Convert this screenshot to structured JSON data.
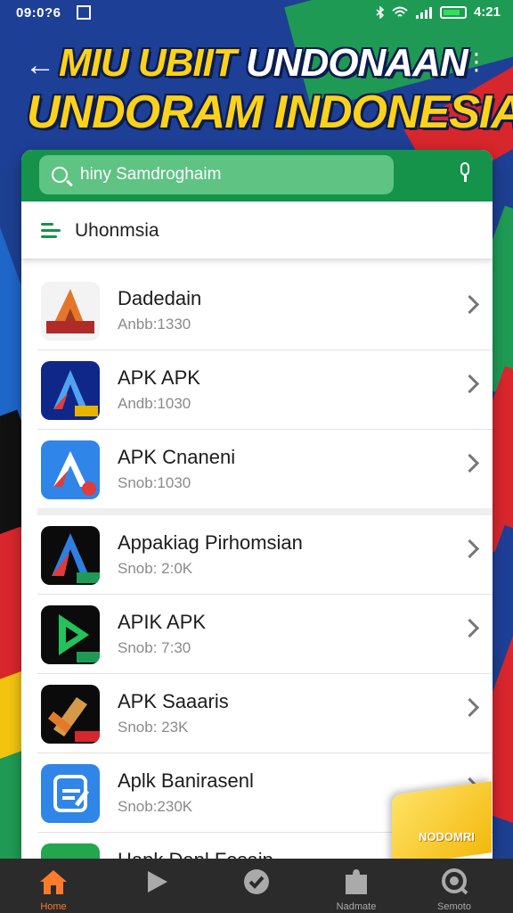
{
  "status_bar": {
    "time": "09:0?6",
    "right_text": "4:21"
  },
  "header": {
    "title_line1_yellow": "MIU UBIIT",
    "title_line1_white": "UNDONAAN",
    "title_line2": "UNDORAM INDONESIA"
  },
  "search": {
    "placeholder": "hiny Samdroghaim",
    "value": ""
  },
  "filter": {
    "label": "Uhonmsia"
  },
  "apps": [
    {
      "title": "Dadedain",
      "subtitle": "Anbb:1330"
    },
    {
      "title": "APK APK",
      "subtitle": "Andb:1030"
    },
    {
      "title": "APK Cnaneni",
      "subtitle": "Snob:1030"
    },
    {
      "title": "Appakiag Pirhomsian",
      "subtitle": "Snob: 2:0K"
    },
    {
      "title": "APIK APK",
      "subtitle": "Snob: 7:30"
    },
    {
      "title": "APK Saaaris",
      "subtitle": "Snob: 23K"
    },
    {
      "title": "Aplk Banirasenl",
      "subtitle": "Snob:230K"
    },
    {
      "title": "Hapk Dapl Fosaip",
      "subtitle": ""
    }
  ],
  "promo": {
    "text": "NODOMRI"
  },
  "nav": {
    "items": [
      {
        "label": "Home"
      },
      {
        "label": ""
      },
      {
        "label": ""
      },
      {
        "label": "Nadmate"
      },
      {
        "label": "Semoto"
      }
    ]
  },
  "colors": {
    "green": "#15934a",
    "accent": "#ff7a2a",
    "yellow": "#ffd21a"
  }
}
